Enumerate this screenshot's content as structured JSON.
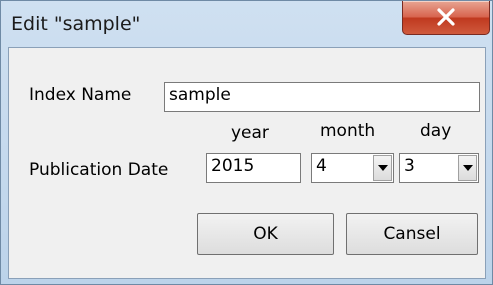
{
  "dialog": {
    "title": "Edit \"sample\""
  },
  "form": {
    "index_name_label": "Index Name",
    "index_name_value": "sample",
    "year_header": "year",
    "month_header": "month",
    "day_header": "day",
    "publication_date_label": "Publication Date",
    "year_value": "2015",
    "month_value": "4",
    "day_value": "3"
  },
  "buttons": {
    "ok_label": "OK",
    "cancel_label": "Cansel"
  },
  "icons": {
    "close": "close-icon",
    "dropdown": "chevron-down-icon"
  }
}
